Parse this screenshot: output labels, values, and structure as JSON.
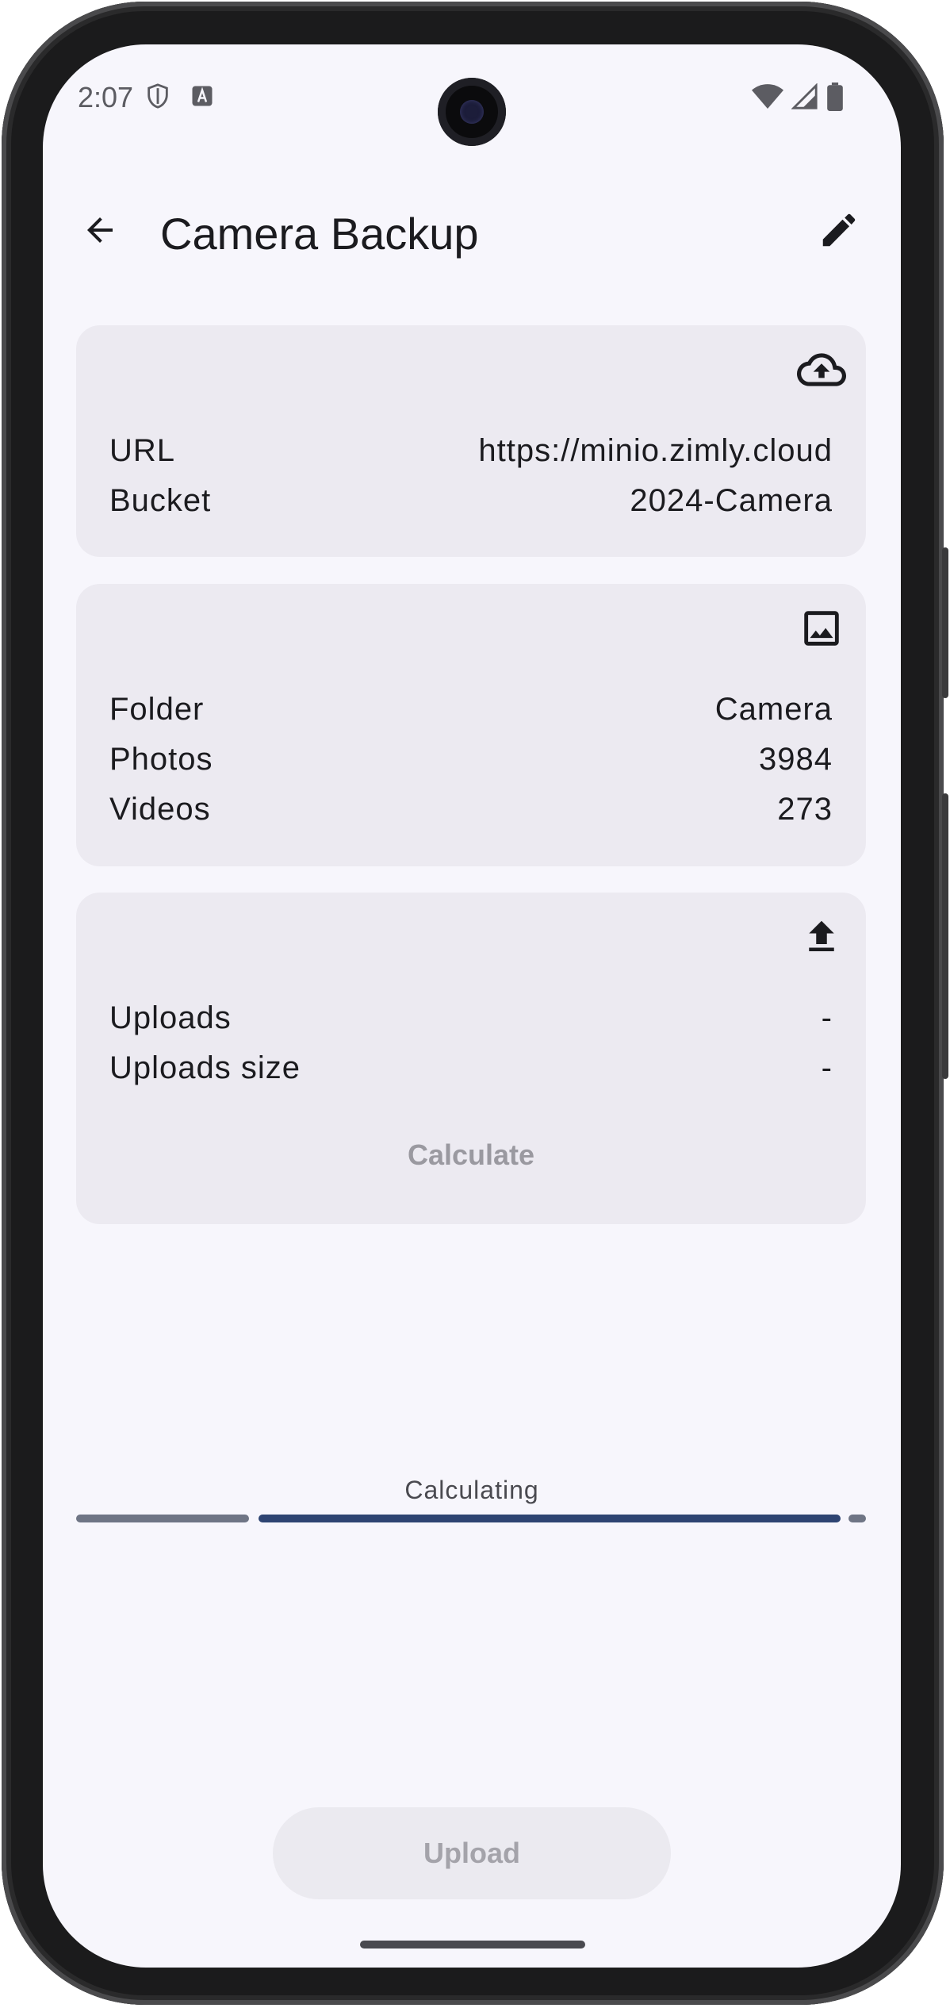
{
  "status": {
    "time": "2:07"
  },
  "appbar": {
    "title": "Camera Backup"
  },
  "cards": {
    "remote": {
      "icon": "cloud-upload-icon",
      "rows": [
        {
          "label": "URL",
          "value": "https://minio.zimly.cloud"
        },
        {
          "label": "Bucket",
          "value": "2024-Camera"
        }
      ]
    },
    "local": {
      "icon": "image-icon",
      "rows": [
        {
          "label": "Folder",
          "value": "Camera"
        },
        {
          "label": "Photos",
          "value": "3984"
        },
        {
          "label": "Videos",
          "value": "273"
        }
      ]
    },
    "diff": {
      "icon": "upload-icon",
      "rows": [
        {
          "label": "Uploads",
          "value": "-"
        },
        {
          "label": "Uploads size",
          "value": "-"
        }
      ],
      "calculate_label": "Calculate"
    }
  },
  "progress": {
    "label": "Calculating",
    "color_active": "#2e4472",
    "color_track": "#6f7585"
  },
  "upload_button": {
    "label": "Upload"
  }
}
